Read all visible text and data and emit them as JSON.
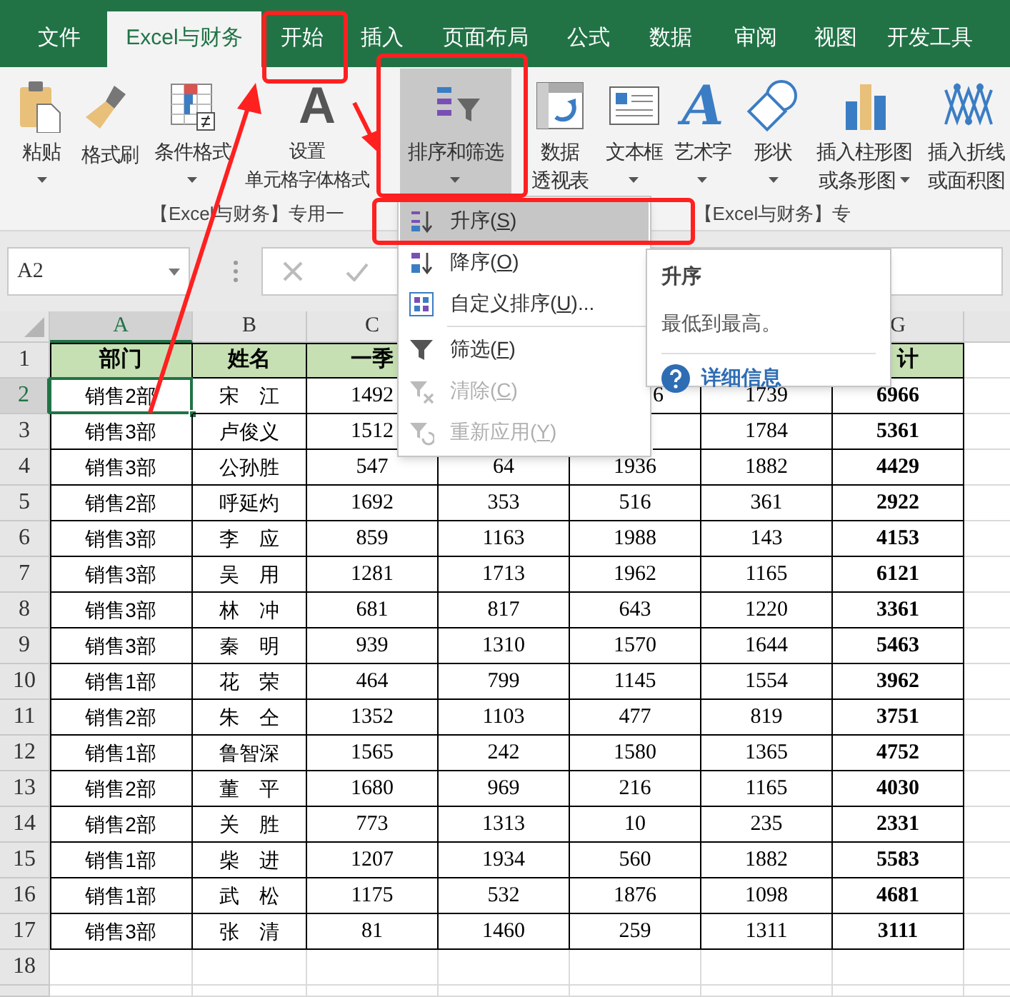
{
  "tabs": [
    {
      "label": "文件",
      "selected": false
    },
    {
      "label": "Excel与财务",
      "selected": true
    },
    {
      "label": "开始",
      "selected": false
    },
    {
      "label": "插入",
      "selected": false
    },
    {
      "label": "页面布局",
      "selected": false
    },
    {
      "label": "公式",
      "selected": false
    },
    {
      "label": "数据",
      "selected": false
    },
    {
      "label": "审阅",
      "selected": false
    },
    {
      "label": "视图",
      "selected": false
    },
    {
      "label": "开发工具",
      "selected": false
    }
  ],
  "ribbon": {
    "buttons": [
      {
        "lines": [
          "粘贴"
        ],
        "caret": true,
        "pressed": false
      },
      {
        "lines": [
          "格式刷"
        ],
        "caret": false,
        "pressed": false
      },
      {
        "lines": [
          "条件格式"
        ],
        "caret": true,
        "pressed": false
      },
      {
        "lines": [
          "设置",
          "单元格字体格式"
        ],
        "caret": false,
        "pressed": false,
        "icon_text": "A"
      },
      {
        "lines": [
          "排序和筛选"
        ],
        "caret": true,
        "pressed": true
      },
      {
        "lines": [
          "数据",
          "透视表"
        ],
        "caret": false,
        "pressed": false
      },
      {
        "lines": [
          "文本框"
        ],
        "caret": true,
        "pressed": false
      },
      {
        "lines": [
          "艺术字"
        ],
        "caret": true,
        "pressed": false,
        "icon_text": "A"
      },
      {
        "lines": [
          "形状"
        ],
        "caret": true,
        "pressed": false
      },
      {
        "lines": [
          "插入柱形图",
          "或条形图"
        ],
        "caret": true,
        "pressed": false
      },
      {
        "lines": [
          "插入折线",
          "或面积图"
        ],
        "caret": false,
        "pressed": false
      }
    ],
    "group_labels": [
      "【Excel与财务】专用一",
      "【Excel与财务】专"
    ]
  },
  "name_box": {
    "value": "A2"
  },
  "sort_menu": {
    "items": [
      {
        "label": "升序(S)",
        "selected": true,
        "disabled": false,
        "divider_after": false
      },
      {
        "label": "降序(O)",
        "selected": false,
        "disabled": false,
        "divider_after": false
      },
      {
        "label": "自定义排序(U)...",
        "selected": false,
        "disabled": false,
        "divider_after": true
      },
      {
        "label": "筛选(F)",
        "selected": false,
        "disabled": false,
        "divider_after": false
      },
      {
        "label": "清除(C)",
        "selected": false,
        "disabled": true,
        "divider_after": false
      },
      {
        "label": "重新应用(Y)",
        "selected": false,
        "disabled": true,
        "divider_after": false
      }
    ]
  },
  "tooltip": {
    "title": "升序",
    "description": "最低到最高。",
    "link": "详细信息"
  },
  "sheet": {
    "columns": [
      {
        "label": "A",
        "selected": true,
        "emphasis": false
      },
      {
        "label": "B",
        "selected": false,
        "emphasis": false
      },
      {
        "label": "C",
        "selected": false,
        "emphasis": false
      },
      null,
      null,
      null,
      {
        "label": "G",
        "selected": false,
        "emphasis": true
      }
    ],
    "rows": [
      {
        "header": "1",
        "kind": "header",
        "selected": false,
        "cells": [
          "部门",
          "姓名",
          "一季",
          null,
          null,
          null,
          {
            "text": "计",
            "partial": true
          }
        ]
      },
      {
        "header": "2",
        "kind": "data",
        "selected": true,
        "cells": [
          "销售2部",
          "宋　江",
          "1492",
          null,
          {
            "text": "6",
            "partial": true
          },
          "1739",
          "6966"
        ]
      },
      {
        "header": "3",
        "kind": "data",
        "selected": false,
        "cells": [
          "销售3部",
          "卢俊义",
          "1512",
          null,
          {
            "partial": true
          },
          "1784",
          "5361"
        ]
      },
      {
        "header": "4",
        "kind": "data",
        "selected": false,
        "cells": [
          "销售3部",
          "公孙胜",
          "547",
          "64",
          "1936",
          "1882",
          "4429"
        ]
      },
      {
        "header": "5",
        "kind": "data",
        "selected": false,
        "cells": [
          "销售2部",
          "呼延灼",
          "1692",
          "353",
          "516",
          "361",
          "2922"
        ]
      },
      {
        "header": "6",
        "kind": "data",
        "selected": false,
        "cells": [
          "销售3部",
          "李　应",
          "859",
          "1163",
          "1988",
          "143",
          "4153"
        ]
      },
      {
        "header": "7",
        "kind": "data",
        "selected": false,
        "cells": [
          "销售3部",
          "吴　用",
          "1281",
          "1713",
          "1962",
          "1165",
          "6121"
        ]
      },
      {
        "header": "8",
        "kind": "data",
        "selected": false,
        "cells": [
          "销售3部",
          "林　冲",
          "681",
          "817",
          "643",
          "1220",
          "3361"
        ]
      },
      {
        "header": "9",
        "kind": "data",
        "selected": false,
        "cells": [
          "销售3部",
          "秦　明",
          "939",
          "1310",
          "1570",
          "1644",
          "5463"
        ]
      },
      {
        "header": "10",
        "kind": "data",
        "selected": false,
        "cells": [
          "销售1部",
          "花　荣",
          "464",
          "799",
          "1145",
          "1554",
          "3962"
        ]
      },
      {
        "header": "11",
        "kind": "data",
        "selected": false,
        "cells": [
          "销售2部",
          "朱　仝",
          "1352",
          "1103",
          "477",
          "819",
          "3751"
        ]
      },
      {
        "header": "12",
        "kind": "data",
        "selected": false,
        "cells": [
          "销售1部",
          "鲁智深",
          "1565",
          "242",
          "1580",
          "1365",
          "4752"
        ]
      },
      {
        "header": "13",
        "kind": "data",
        "selected": false,
        "cells": [
          "销售2部",
          "董　平",
          "1680",
          "969",
          "216",
          "1165",
          "4030"
        ]
      },
      {
        "header": "14",
        "kind": "data",
        "selected": false,
        "cells": [
          "销售2部",
          "关　胜",
          "773",
          "1313",
          "10",
          "235",
          "2331"
        ]
      },
      {
        "header": "15",
        "kind": "data",
        "selected": false,
        "cells": [
          "销售1部",
          "柴　进",
          "1207",
          "1934",
          "560",
          "1882",
          "5583"
        ]
      },
      {
        "header": "16",
        "kind": "data",
        "selected": false,
        "cells": [
          "销售1部",
          "武　松",
          "1175",
          "532",
          "1876",
          "1098",
          "4681"
        ]
      },
      {
        "header": "17",
        "kind": "data",
        "selected": false,
        "cells": [
          "销售3部",
          "张　清",
          "81",
          "1460",
          "259",
          "1311",
          "3111"
        ]
      },
      {
        "header": "18",
        "kind": "empty",
        "selected": false
      }
    ]
  }
}
